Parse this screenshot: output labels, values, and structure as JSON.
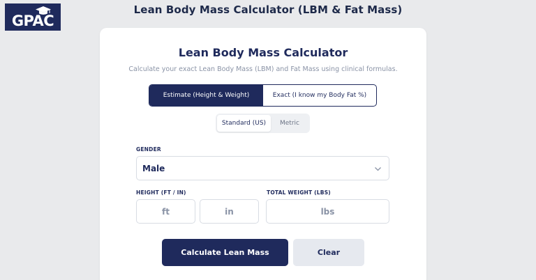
{
  "logo": {
    "text": "GPAC"
  },
  "page": {
    "title": "Lean Body Mass Calculator (LBM & Fat Mass)"
  },
  "card": {
    "title": "Lean Body Mass Calculator",
    "subtitle": "Calculate your exact Lean Body Mass (LBM) and Fat Mass using clinical formulas."
  },
  "mode": {
    "estimate_label": "Estimate (Height & Weight)",
    "exact_label": "Exact (I know my Body Fat %)",
    "selected": "Estimate (Height & Weight)"
  },
  "units": {
    "standard_label": "Standard (US)",
    "metric_label": "Metric",
    "selected": "Standard (US)"
  },
  "gender": {
    "label": "GENDER",
    "value": "Male"
  },
  "height": {
    "label": "HEIGHT (FT / IN)",
    "ft_placeholder": "ft",
    "in_placeholder": "in"
  },
  "weight": {
    "label": "TOTAL WEIGHT (LBS)",
    "placeholder": "lbs"
  },
  "actions": {
    "calculate_label": "Calculate Lean Mass",
    "clear_label": "Clear"
  },
  "colors": {
    "primary": "#1f2a5c",
    "background": "#e9eaec",
    "secondary_button": "#e6e9ef"
  },
  "icons": {
    "logo_cap": "graduation-cap-icon",
    "select_caret": "chevron-down-icon"
  }
}
